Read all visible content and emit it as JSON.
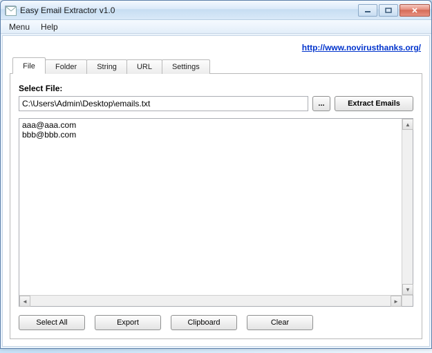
{
  "window": {
    "title": "Easy Email Extractor v1.0"
  },
  "menu": {
    "items": [
      "Menu",
      "Help"
    ]
  },
  "link": {
    "text": "http://www.novirusthanks.org/",
    "href": "http://www.novirusthanks.org/"
  },
  "tabs": {
    "items": [
      "File",
      "Folder",
      "String",
      "URL",
      "Settings"
    ],
    "active_index": 0
  },
  "file_tab": {
    "label": "Select File:",
    "path": "C:\\Users\\Admin\\Desktop\\emails.txt",
    "browse_label": "...",
    "extract_label": "Extract Emails",
    "results": [
      "aaa@aaa.com",
      "bbb@bbb.com"
    ]
  },
  "buttons": {
    "select_all": "Select All",
    "export": "Export",
    "clipboard": "Clipboard",
    "clear": "Clear"
  }
}
